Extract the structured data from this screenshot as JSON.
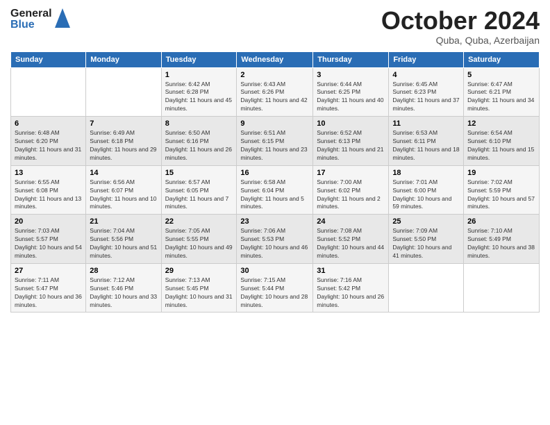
{
  "header": {
    "logo": {
      "general": "General",
      "blue": "Blue"
    },
    "title": "October 2024",
    "location": "Quba, Quba, Azerbaijan"
  },
  "weekdays": [
    "Sunday",
    "Monday",
    "Tuesday",
    "Wednesday",
    "Thursday",
    "Friday",
    "Saturday"
  ],
  "weeks": [
    [
      {
        "day": "",
        "info": ""
      },
      {
        "day": "",
        "info": ""
      },
      {
        "day": "1",
        "info": "Sunrise: 6:42 AM\nSunset: 6:28 PM\nDaylight: 11 hours and 45 minutes."
      },
      {
        "day": "2",
        "info": "Sunrise: 6:43 AM\nSunset: 6:26 PM\nDaylight: 11 hours and 42 minutes."
      },
      {
        "day": "3",
        "info": "Sunrise: 6:44 AM\nSunset: 6:25 PM\nDaylight: 11 hours and 40 minutes."
      },
      {
        "day": "4",
        "info": "Sunrise: 6:45 AM\nSunset: 6:23 PM\nDaylight: 11 hours and 37 minutes."
      },
      {
        "day": "5",
        "info": "Sunrise: 6:47 AM\nSunset: 6:21 PM\nDaylight: 11 hours and 34 minutes."
      }
    ],
    [
      {
        "day": "6",
        "info": "Sunrise: 6:48 AM\nSunset: 6:20 PM\nDaylight: 11 hours and 31 minutes."
      },
      {
        "day": "7",
        "info": "Sunrise: 6:49 AM\nSunset: 6:18 PM\nDaylight: 11 hours and 29 minutes."
      },
      {
        "day": "8",
        "info": "Sunrise: 6:50 AM\nSunset: 6:16 PM\nDaylight: 11 hours and 26 minutes."
      },
      {
        "day": "9",
        "info": "Sunrise: 6:51 AM\nSunset: 6:15 PM\nDaylight: 11 hours and 23 minutes."
      },
      {
        "day": "10",
        "info": "Sunrise: 6:52 AM\nSunset: 6:13 PM\nDaylight: 11 hours and 21 minutes."
      },
      {
        "day": "11",
        "info": "Sunrise: 6:53 AM\nSunset: 6:11 PM\nDaylight: 11 hours and 18 minutes."
      },
      {
        "day": "12",
        "info": "Sunrise: 6:54 AM\nSunset: 6:10 PM\nDaylight: 11 hours and 15 minutes."
      }
    ],
    [
      {
        "day": "13",
        "info": "Sunrise: 6:55 AM\nSunset: 6:08 PM\nDaylight: 11 hours and 13 minutes."
      },
      {
        "day": "14",
        "info": "Sunrise: 6:56 AM\nSunset: 6:07 PM\nDaylight: 11 hours and 10 minutes."
      },
      {
        "day": "15",
        "info": "Sunrise: 6:57 AM\nSunset: 6:05 PM\nDaylight: 11 hours and 7 minutes."
      },
      {
        "day": "16",
        "info": "Sunrise: 6:58 AM\nSunset: 6:04 PM\nDaylight: 11 hours and 5 minutes."
      },
      {
        "day": "17",
        "info": "Sunrise: 7:00 AM\nSunset: 6:02 PM\nDaylight: 11 hours and 2 minutes."
      },
      {
        "day": "18",
        "info": "Sunrise: 7:01 AM\nSunset: 6:00 PM\nDaylight: 10 hours and 59 minutes."
      },
      {
        "day": "19",
        "info": "Sunrise: 7:02 AM\nSunset: 5:59 PM\nDaylight: 10 hours and 57 minutes."
      }
    ],
    [
      {
        "day": "20",
        "info": "Sunrise: 7:03 AM\nSunset: 5:57 PM\nDaylight: 10 hours and 54 minutes."
      },
      {
        "day": "21",
        "info": "Sunrise: 7:04 AM\nSunset: 5:56 PM\nDaylight: 10 hours and 51 minutes."
      },
      {
        "day": "22",
        "info": "Sunrise: 7:05 AM\nSunset: 5:55 PM\nDaylight: 10 hours and 49 minutes."
      },
      {
        "day": "23",
        "info": "Sunrise: 7:06 AM\nSunset: 5:53 PM\nDaylight: 10 hours and 46 minutes."
      },
      {
        "day": "24",
        "info": "Sunrise: 7:08 AM\nSunset: 5:52 PM\nDaylight: 10 hours and 44 minutes."
      },
      {
        "day": "25",
        "info": "Sunrise: 7:09 AM\nSunset: 5:50 PM\nDaylight: 10 hours and 41 minutes."
      },
      {
        "day": "26",
        "info": "Sunrise: 7:10 AM\nSunset: 5:49 PM\nDaylight: 10 hours and 38 minutes."
      }
    ],
    [
      {
        "day": "27",
        "info": "Sunrise: 7:11 AM\nSunset: 5:47 PM\nDaylight: 10 hours and 36 minutes."
      },
      {
        "day": "28",
        "info": "Sunrise: 7:12 AM\nSunset: 5:46 PM\nDaylight: 10 hours and 33 minutes."
      },
      {
        "day": "29",
        "info": "Sunrise: 7:13 AM\nSunset: 5:45 PM\nDaylight: 10 hours and 31 minutes."
      },
      {
        "day": "30",
        "info": "Sunrise: 7:15 AM\nSunset: 5:44 PM\nDaylight: 10 hours and 28 minutes."
      },
      {
        "day": "31",
        "info": "Sunrise: 7:16 AM\nSunset: 5:42 PM\nDaylight: 10 hours and 26 minutes."
      },
      {
        "day": "",
        "info": ""
      },
      {
        "day": "",
        "info": ""
      }
    ]
  ]
}
